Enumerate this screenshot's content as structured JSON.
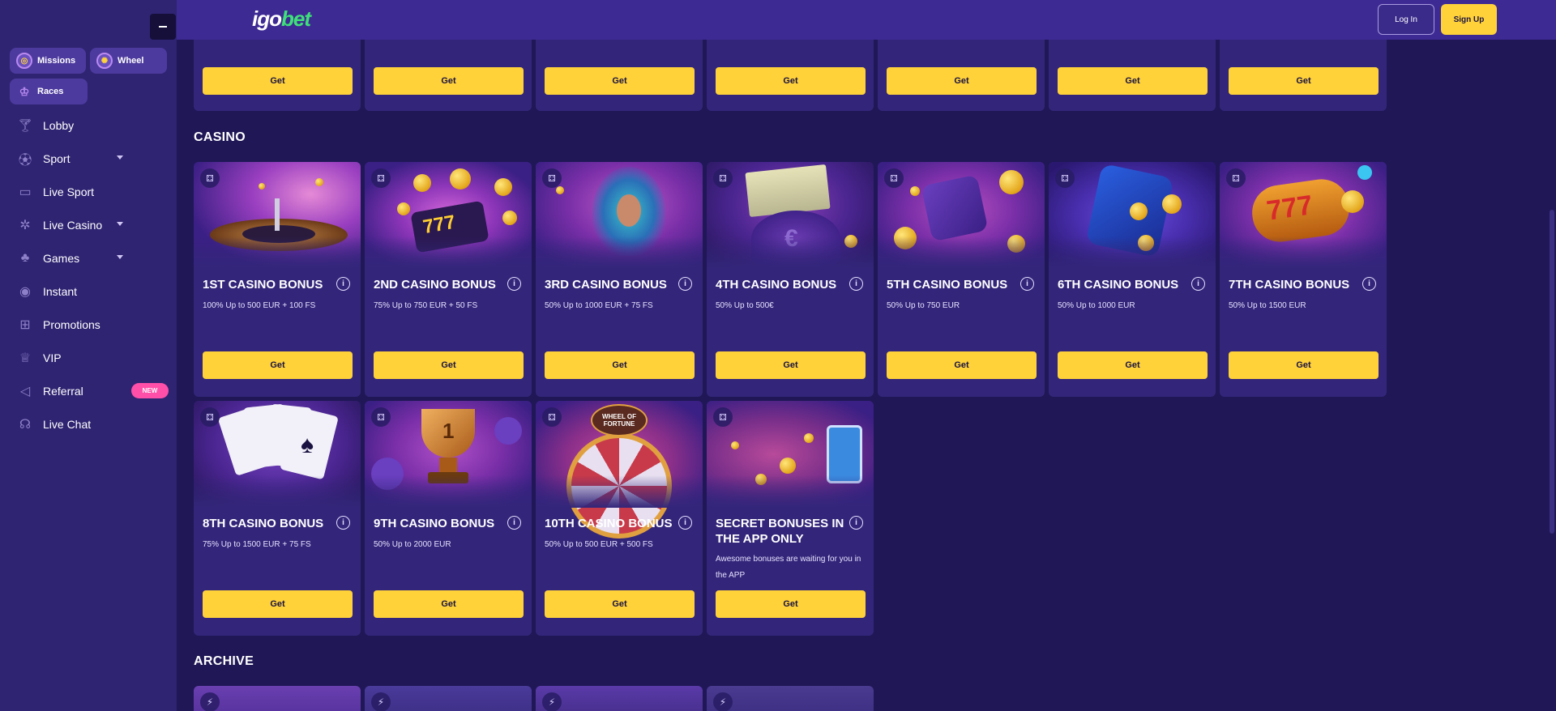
{
  "brand": {
    "logo_part1": "igo",
    "logo_part2": "bet"
  },
  "header": {
    "login_label": "Log In",
    "signup_label": "Sign Up"
  },
  "sidebar": {
    "pills": [
      {
        "label": "Missions",
        "icon": "target-icon"
      },
      {
        "label": "Wheel",
        "icon": "wheel-icon"
      },
      {
        "label": "Races",
        "icon": "trophy-icon"
      }
    ],
    "items": [
      {
        "label": "Lobby",
        "icon": "cocktail-icon"
      },
      {
        "label": "Sport",
        "icon": "football-icon",
        "dropdown": true
      },
      {
        "label": "Live Sport",
        "icon": "tv-icon"
      },
      {
        "label": "Live Casino",
        "icon": "roulette-icon",
        "dropdown": true
      },
      {
        "label": "Games",
        "icon": "cards-icon",
        "dropdown": true
      },
      {
        "label": "Instant",
        "icon": "target-icon"
      },
      {
        "label": "Promotions",
        "icon": "gift-icon"
      },
      {
        "label": "VIP",
        "icon": "crown-icon"
      },
      {
        "label": "Referral",
        "icon": "megaphone-icon",
        "badge": "NEW"
      },
      {
        "label": "Live Chat",
        "icon": "headset-icon"
      }
    ]
  },
  "top_row": {
    "get_label": "Get",
    "count": 7
  },
  "casino": {
    "title": "CASINO",
    "cards": [
      {
        "title": "1ST CASINO BONUS",
        "desc": "100% Up to 500 EUR + 100 FS",
        "get": "Get"
      },
      {
        "title": "2ND CASINO BONUS",
        "desc": "75% Up to 750 EUR + 50 FS",
        "get": "Get"
      },
      {
        "title": "3RD CASINO BONUS",
        "desc": "50% Up to 1000 EUR + 75 FS",
        "get": "Get"
      },
      {
        "title": "4TH CASINO BONUS",
        "desc": "50% Up to 500€",
        "get": "Get"
      },
      {
        "title": "5TH CASINO BONUS",
        "desc": "50% Up to 750 EUR",
        "get": "Get"
      },
      {
        "title": "6TH CASINO BONUS",
        "desc": "50% Up to 1000 EUR",
        "get": "Get"
      },
      {
        "title": "7TH CASINO BONUS",
        "desc": "50% Up to 1500 EUR",
        "get": "Get"
      },
      {
        "title": "8TH CASINO BONUS",
        "desc": "75% Up to 1500 EUR + 75 FS",
        "get": "Get"
      },
      {
        "title": "9TH CASINO BONUS",
        "desc": "50% Up to 2000 EUR",
        "get": "Get"
      },
      {
        "title": "10TH CASINO BONUS",
        "desc": "50% Up to 500 EUR + 500 FS",
        "get": "Get"
      },
      {
        "title": "SECRET BONUSES IN THE APP ONLY",
        "desc": "Awesome bonuses are waiting for you in the APP",
        "get": "Get"
      }
    ]
  },
  "illustrations": {
    "wheel_text": "WHEEL OF FORTUNE",
    "slot_777": "777",
    "trophy_digit": "1",
    "euro": "€"
  },
  "archive": {
    "title": "ARCHIVE"
  },
  "colors": {
    "accent": "#ffd23a",
    "sidebar": "#2f2472",
    "header": "#3e2a93",
    "card": "#33267a",
    "background": "#1f1756",
    "new_badge": "#ff4fa8"
  }
}
